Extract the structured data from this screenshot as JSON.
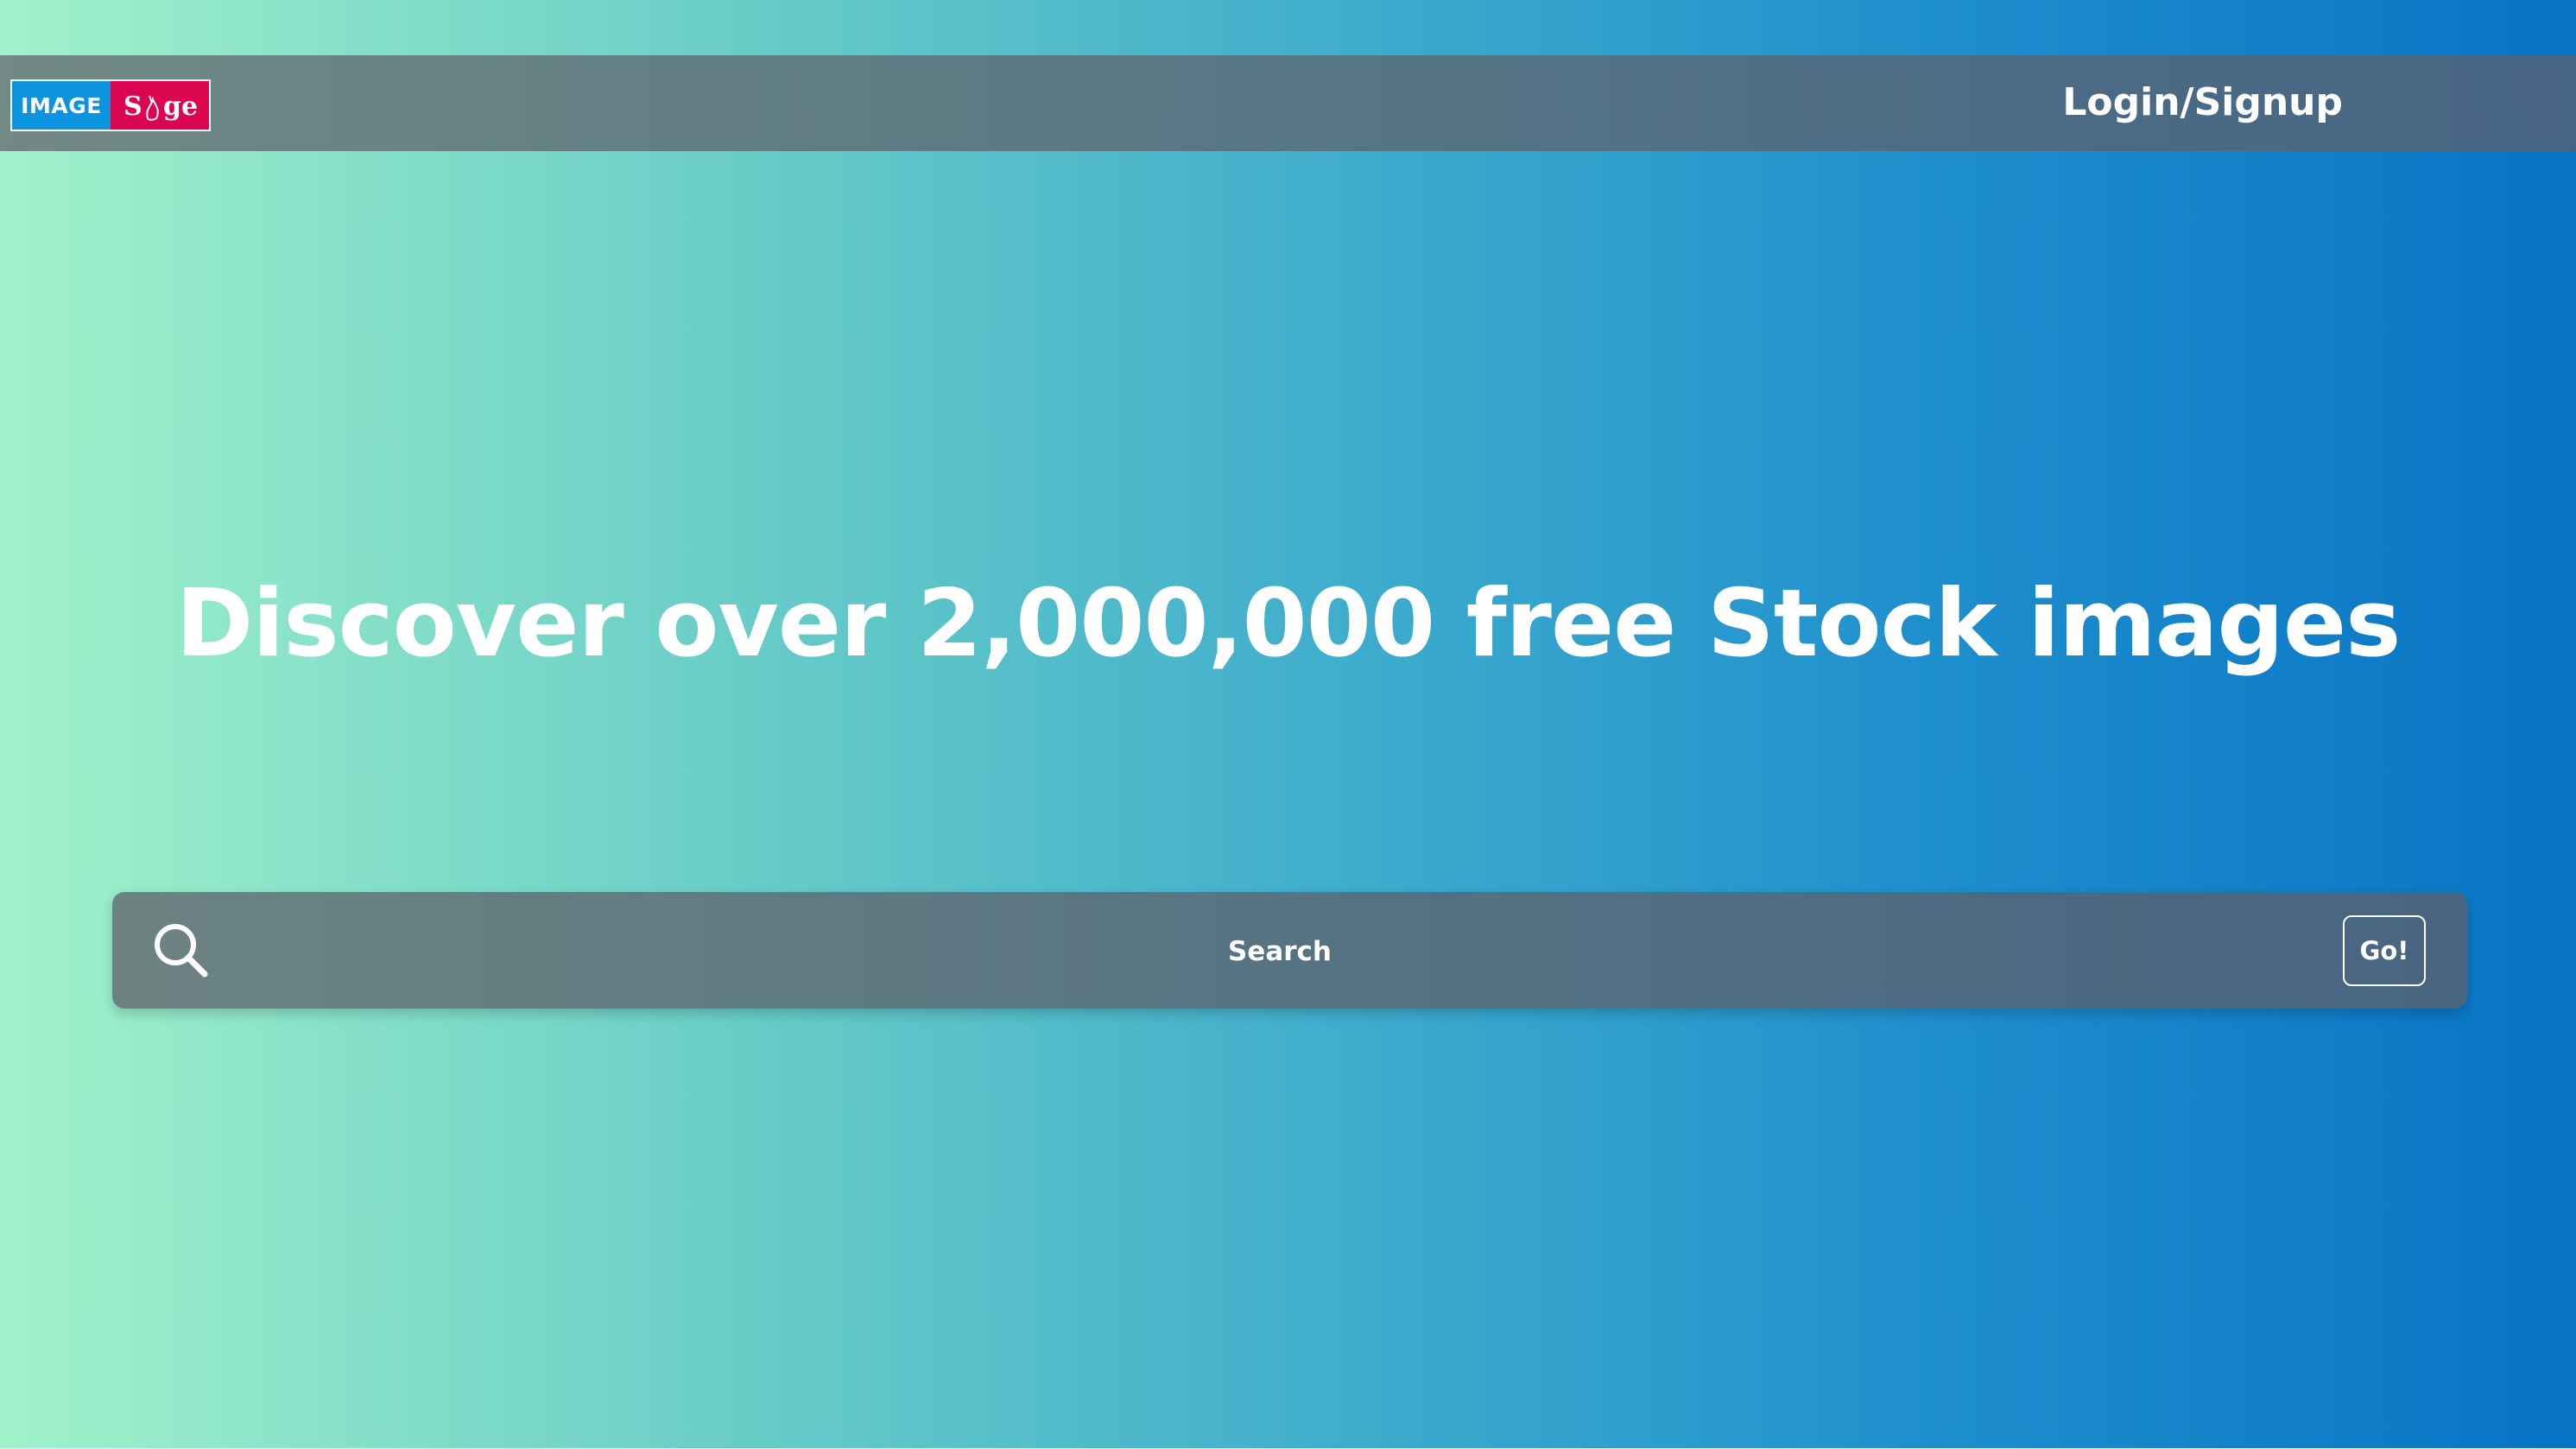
{
  "brand": {
    "logo_left": "IMAGE",
    "logo_right": "Sage",
    "color_left": "#0c95de",
    "color_right": "#dc0650"
  },
  "nav": {
    "login_label": "Login/Signup"
  },
  "hero": {
    "headline": "Discover over 2,000,000 free Stock images",
    "gradient_start": "#a1f2ca",
    "gradient_end": "#0773c4"
  },
  "search": {
    "placeholder": "Search",
    "value": "",
    "go_label": "Go!",
    "icon": "search-icon"
  }
}
